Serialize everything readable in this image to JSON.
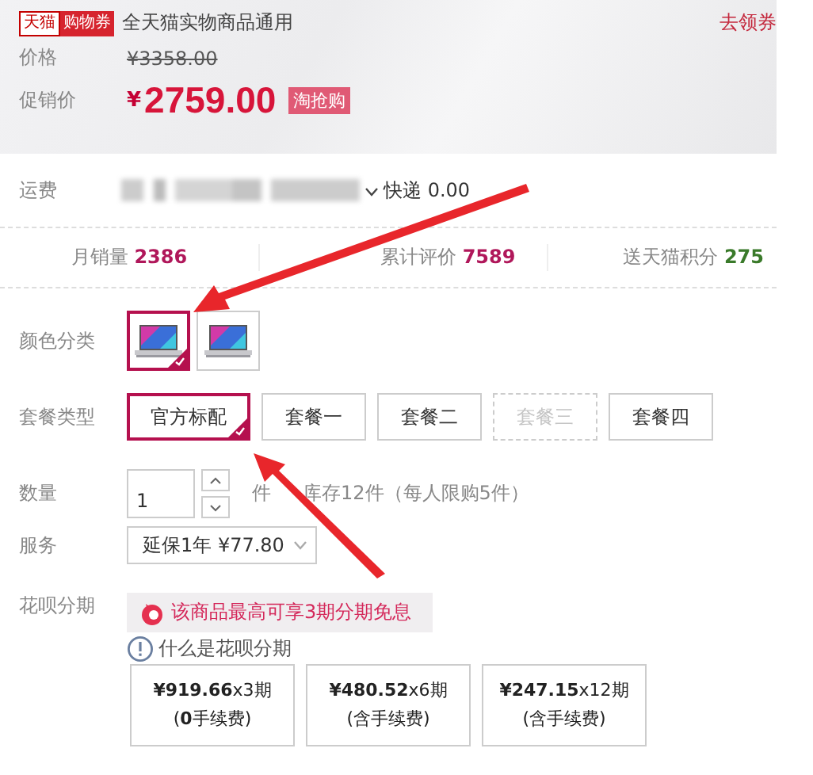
{
  "coupon": {
    "brand": "天猫",
    "type": "购物券",
    "text": "全天猫实物商品通用",
    "link": "去领券"
  },
  "price": {
    "label": "价格",
    "value": "¥3358.00"
  },
  "promo": {
    "label": "促销价",
    "currency": "¥",
    "value": "2759.00",
    "tag": "淘抢购"
  },
  "shipping": {
    "label": "运费",
    "method": "快递 0.00"
  },
  "stats": [
    {
      "label": "月销量",
      "value": "2386",
      "color": "#b0175a"
    },
    {
      "label": "累计评价",
      "value": "7589",
      "color": "#b0175a"
    },
    {
      "label": "送天猫积分",
      "value": "275",
      "color": "#3a7a2a"
    }
  ],
  "colors": {
    "label": "颜色分类",
    "items": [
      {
        "selected": true
      },
      {
        "selected": false
      }
    ]
  },
  "packages": {
    "label": "套餐类型",
    "items": [
      {
        "label": "官方标配",
        "selected": true,
        "disabled": false
      },
      {
        "label": "套餐一",
        "selected": false,
        "disabled": false
      },
      {
        "label": "套餐二",
        "selected": false,
        "disabled": false
      },
      {
        "label": "套餐三",
        "selected": false,
        "disabled": true
      },
      {
        "label": "套餐四",
        "selected": false,
        "disabled": false
      }
    ]
  },
  "quantity": {
    "label": "数量",
    "value": "1",
    "unit": "件",
    "stock": "库存12件（每人限购5件）"
  },
  "service": {
    "label": "服务",
    "value": "延保1年 ¥77.80"
  },
  "huabei": {
    "label": "花呗分期",
    "promo": "该商品最高可享3期分期免息",
    "help": "什么是花呗分期",
    "plans": [
      {
        "price": "**¥919.66**x3期",
        "fee": "(**0**手续费)"
      },
      {
        "price": "**¥480.52**x6期",
        "fee": "(含手续费)"
      },
      {
        "price": "**¥247.15**x12期",
        "fee": "(含手续费)"
      }
    ]
  }
}
